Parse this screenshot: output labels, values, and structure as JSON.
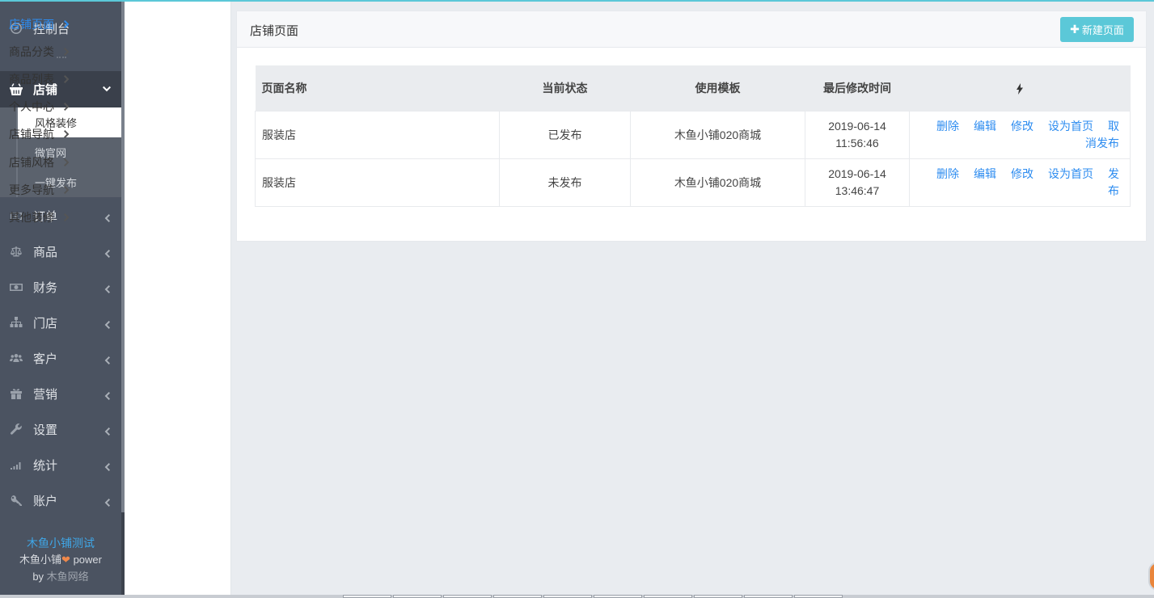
{
  "sidebar": {
    "dashboard": {
      "label": "控制台",
      "icon": "compass-icon"
    },
    "active": {
      "label": "店铺",
      "icon": "basket-icon"
    },
    "sub_items": [
      {
        "label": "风格装修",
        "selected": true
      },
      {
        "label": "微官网",
        "selected": false
      },
      {
        "label": "一键发布",
        "selected": false
      }
    ],
    "items": [
      {
        "label": "订单",
        "icon": "money-icon"
      },
      {
        "label": "商品",
        "icon": "scale-icon"
      },
      {
        "label": "财务",
        "icon": "cash-icon"
      },
      {
        "label": "门店",
        "icon": "sitemap-icon"
      },
      {
        "label": "客户",
        "icon": "users-icon"
      },
      {
        "label": "营销",
        "icon": "gift-icon"
      },
      {
        "label": "设置",
        "icon": "wrench-icon"
      },
      {
        "label": "统计",
        "icon": "signal-icon"
      },
      {
        "label": "账户",
        "icon": "key-icon"
      }
    ],
    "footer": {
      "shop_name": "木鱼小铺测试",
      "brand": "木鱼小铺",
      "heart": "❤",
      "power": "power",
      "by": "by",
      "company": "木鱼网络"
    }
  },
  "submenu": {
    "items": [
      {
        "label": "店铺页面",
        "selected": true
      },
      {
        "label": "商品分类",
        "selected": false
      },
      {
        "label": "商品列表",
        "selected": false
      },
      {
        "label": "个人中心",
        "selected": false
      },
      {
        "label": "店铺导航",
        "selected": false
      },
      {
        "label": "店铺风格",
        "selected": false
      },
      {
        "label": "更多导航",
        "selected": false
      },
      {
        "label": "其他装修",
        "selected": false
      }
    ]
  },
  "panel": {
    "title": "店铺页面",
    "new_button": {
      "icon": "plus-icon",
      "label": "新建页面"
    },
    "columns": [
      "页面名称",
      "当前状态",
      "使用模板",
      "最后修改时间"
    ],
    "actions_header_icon": "bolt-icon",
    "rows": [
      {
        "name": "服装店",
        "status": "已发布",
        "template": "木鱼小铺020商城",
        "date": "2019-06-14",
        "time": "11:56:46",
        "actions": [
          "删除",
          "编辑",
          "修改",
          "设为首页",
          "取消发布"
        ]
      },
      {
        "name": "服装店",
        "status": "未发布",
        "template": "木鱼小铺020商城",
        "date": "2019-06-14",
        "time": "13:46:47",
        "actions": [
          "删除",
          "编辑",
          "修改",
          "设为首页",
          "发布"
        ]
      }
    ]
  },
  "colors": {
    "accent": "#5bc8d8",
    "link": "#2d8cf0",
    "sidebar_bg": "#4b5361",
    "sidebar_active_bg": "#3a404b",
    "footer_link": "#3fa7e8",
    "heart": "#f0884a"
  }
}
